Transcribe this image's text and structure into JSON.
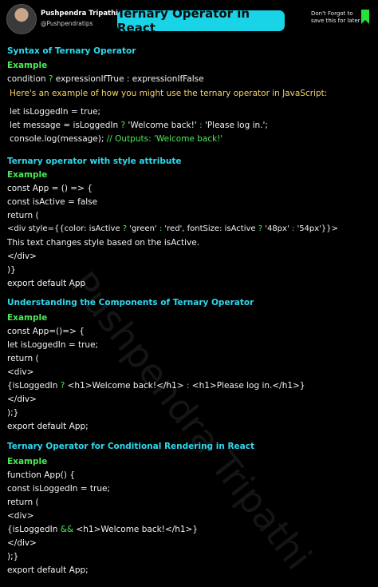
{
  "header": {
    "author_name": "Pushpendra Tripathi",
    "author_handle": "@Pushpendratips",
    "title": "Ternary Operator in React",
    "save_line1": "Don't Forgot to",
    "save_line2": "save this for later"
  },
  "watermark": "Pushpendra Tripathi",
  "sections": {
    "s1": {
      "heading": "Syntax of Ternary Operator",
      "example": "Example",
      "syntax_a": "condition ",
      "syntax_q": "?",
      "syntax_b": " expressionIfTrue : expressionIfFalse",
      "note": "Here's an example of how you might use the ternary operator in JavaScript:",
      "l1": "let isLoggedIn = true;",
      "l2a": "let message = isLoggedIn ",
      "l2q": "?",
      "l2b": " 'Welcome back!' ",
      "l2c": ":",
      "l2d": " 'Please log in.';",
      "l3a": "console.log(message); ",
      "l3b": "// Outputs: 'Welcome back!'"
    },
    "s2": {
      "heading": "Ternary operator with style attribute",
      "example": "Example",
      "l1": "const App = () => {",
      "l2": "const isActive = false",
      "l3": "return (",
      "l4a": "<div style={{color: isActive ",
      "l4q": "?",
      "l4b": " 'green' ",
      "l4c": ":",
      "l4d": " 'red', fontSize: isActive ",
      "l4e": "?",
      "l4f": " '48px' ",
      "l4g": ":",
      "l4h": " '54px'}}>",
      "l5": "This text changes style based on the isActive.",
      "l6": "</div>",
      "l7": ")}",
      "l8": "export default App"
    },
    "s3": {
      "heading": "Understanding the Components of Ternary Operator",
      "example": "Example",
      "l1": "const App=()=> {",
      "l2": "let isLoggedIn = true;",
      "l3": "return (",
      "l4": "<div>",
      "l5a": "{isLoggedIn ",
      "l5q": "?",
      "l5b": " <h1>Welcome back!</h1> ",
      "l5c": ":",
      "l5d": " <h1>Please log in.</h1>}",
      "l6": "</div>",
      "l7": ");}",
      "l8": "export default App;"
    },
    "s4": {
      "heading": "Ternary Operator for Conditional Rendering in React",
      "example": "Example",
      "l1": "function App() {",
      "l2": "const isLoggedIn = true;",
      "l3": "return (",
      "l4": "<div>",
      "l5a": "{isLoggedIn ",
      "l5b": "&&",
      "l5c": " <h1>Welcome back!</h1>}",
      "l6": "</div>",
      "l7": ");}",
      "l8": "export default App;"
    }
  },
  "colors": {
    "background": "#000000",
    "heading": "#2fd9ee",
    "example": "#4cea55",
    "note": "#f4d36a",
    "operator": "#4cea55",
    "title_pill": "#19d3e6"
  }
}
